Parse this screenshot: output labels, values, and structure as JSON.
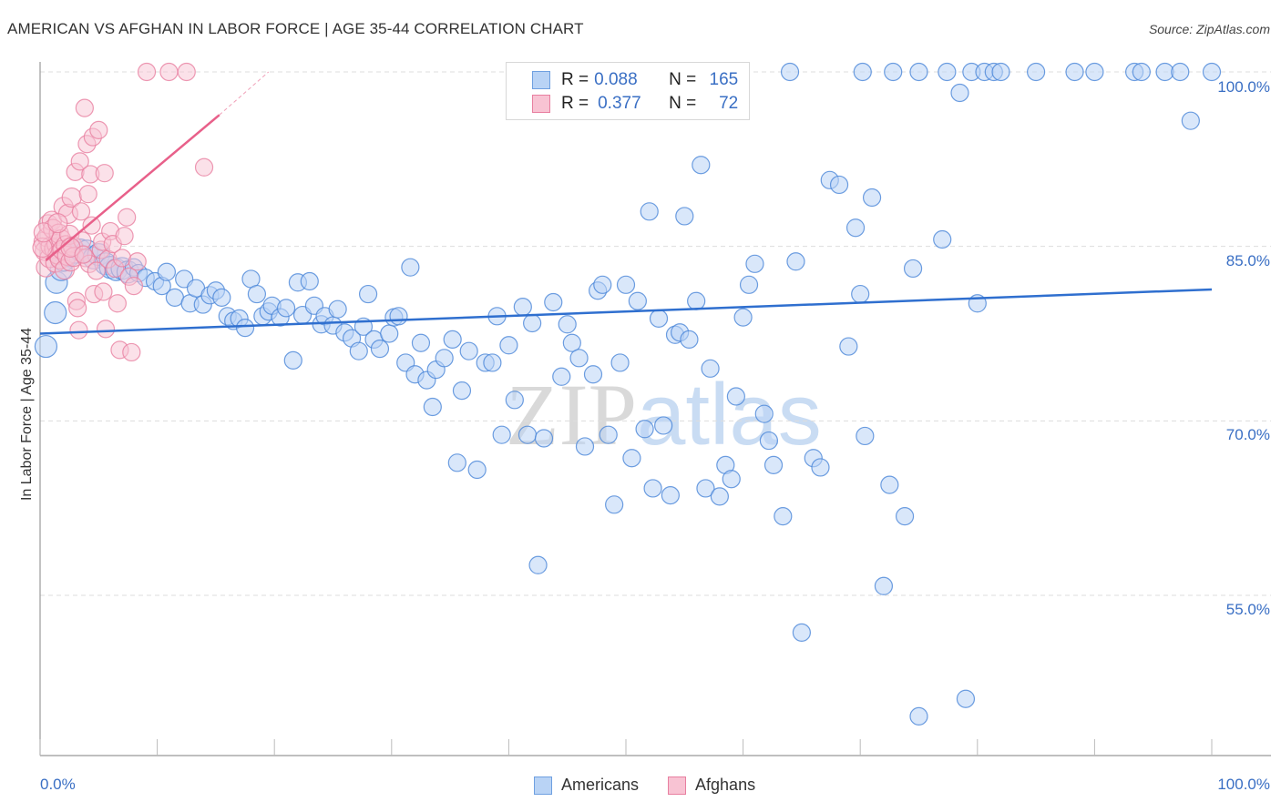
{
  "header": {
    "title": "AMERICAN VS AFGHAN IN LABOR FORCE | AGE 35-44 CORRELATION CHART",
    "source": "Source: ZipAtlas.com"
  },
  "watermark": {
    "zip": "ZIP",
    "atlas": "atlas"
  },
  "legend": {
    "rows": [
      {
        "r_label": "R = ",
        "r_value": "0.088",
        "n_label": "N = ",
        "n_value": "165",
        "color": "#6fa0e0",
        "fill": "#b9d3f5"
      },
      {
        "r_label": "R = ",
        "r_value": "0.377",
        "n_label": "N = ",
        "n_value": "72",
        "color": "#e87fa0",
        "fill": "#f8c3d3"
      }
    ]
  },
  "bottom_legend": [
    {
      "label": "Americans",
      "color": "#6fa0e0",
      "fill": "#b9d3f5"
    },
    {
      "label": "Afghans",
      "color": "#e87fa0",
      "fill": "#f8c3d3"
    }
  ],
  "chart_data": {
    "type": "scatter",
    "title": "AMERICAN VS AFGHAN IN LABOR FORCE | AGE 35-44 CORRELATION CHART",
    "xlabel": "",
    "ylabel": "In Labor Force | Age 35-44",
    "xlim": [
      0,
      100
    ],
    "ylim": [
      41.2,
      100
    ],
    "x_tick_labels": [
      "0.0%",
      "100.0%"
    ],
    "y_ticks": [
      100,
      85,
      70,
      55
    ],
    "y_tick_labels": [
      "100.0%",
      "85.0%",
      "70.0%",
      "55.0%"
    ],
    "grid": true,
    "legend_position": "top-center",
    "series": [
      {
        "name": "Americans",
        "color": "#4a86d8",
        "fill": "#b9d3f5",
        "R": 0.088,
        "N": 165,
        "trend": {
          "x": [
            0,
            100
          ],
          "y": [
            77.5,
            81.3
          ]
        },
        "points": [
          [
            0.5,
            76.4
          ],
          [
            1.3,
            79.3
          ],
          [
            1.4,
            81.9
          ],
          [
            1.8,
            83.0
          ],
          [
            2.0,
            83.8
          ],
          [
            2.5,
            84.2
          ],
          [
            3.0,
            84.5
          ],
          [
            3.4,
            84.7
          ],
          [
            4.0,
            84.6
          ],
          [
            4.6,
            84.0
          ],
          [
            5.0,
            84.3
          ],
          [
            5.6,
            83.5
          ],
          [
            6.0,
            83.2
          ],
          [
            6.5,
            83.0
          ],
          [
            7.0,
            83.1
          ],
          [
            7.5,
            82.8
          ],
          [
            8.0,
            83.2
          ],
          [
            8.4,
            82.7
          ],
          [
            9.0,
            82.3
          ],
          [
            9.8,
            82.0
          ],
          [
            10.4,
            81.6
          ],
          [
            10.8,
            82.8
          ],
          [
            11.5,
            80.6
          ],
          [
            12.3,
            82.2
          ],
          [
            12.8,
            80.1
          ],
          [
            13.3,
            81.4
          ],
          [
            13.9,
            80.0
          ],
          [
            14.5,
            80.8
          ],
          [
            15.0,
            81.2
          ],
          [
            15.5,
            80.6
          ],
          [
            16.0,
            79.0
          ],
          [
            16.5,
            78.6
          ],
          [
            17.0,
            78.8
          ],
          [
            17.5,
            78.0
          ],
          [
            18.0,
            82.2
          ],
          [
            18.5,
            80.9
          ],
          [
            19.0,
            79.0
          ],
          [
            19.5,
            79.4
          ],
          [
            19.8,
            79.9
          ],
          [
            20.5,
            78.9
          ],
          [
            21.0,
            79.7
          ],
          [
            21.6,
            75.2
          ],
          [
            22.0,
            81.9
          ],
          [
            22.4,
            79.1
          ],
          [
            23.0,
            82.0
          ],
          [
            23.4,
            79.9
          ],
          [
            24.0,
            78.3
          ],
          [
            24.3,
            79.0
          ],
          [
            25.0,
            78.2
          ],
          [
            25.4,
            79.6
          ],
          [
            26.0,
            77.6
          ],
          [
            26.6,
            77.1
          ],
          [
            27.2,
            76.0
          ],
          [
            27.6,
            78.1
          ],
          [
            28.0,
            80.9
          ],
          [
            28.5,
            77.0
          ],
          [
            29.0,
            76.2
          ],
          [
            29.8,
            77.5
          ],
          [
            30.2,
            78.9
          ],
          [
            30.6,
            79.0
          ],
          [
            31.2,
            75.0
          ],
          [
            31.6,
            83.2
          ],
          [
            32.0,
            74.0
          ],
          [
            32.5,
            76.7
          ],
          [
            33.0,
            73.5
          ],
          [
            33.5,
            71.2
          ],
          [
            33.8,
            74.4
          ],
          [
            34.5,
            75.4
          ],
          [
            35.2,
            77.0
          ],
          [
            35.6,
            66.4
          ],
          [
            36.0,
            72.6
          ],
          [
            36.6,
            76.0
          ],
          [
            37.3,
            65.8
          ],
          [
            38.0,
            75.0
          ],
          [
            38.6,
            75.0
          ],
          [
            39.0,
            79.0
          ],
          [
            39.4,
            68.8
          ],
          [
            40.0,
            76.5
          ],
          [
            40.5,
            71.8
          ],
          [
            41.2,
            79.8
          ],
          [
            41.6,
            68.8
          ],
          [
            42.0,
            78.4
          ],
          [
            42.5,
            57.6
          ],
          [
            43.0,
            68.5
          ],
          [
            43.8,
            80.2
          ],
          [
            44.5,
            73.8
          ],
          [
            45.0,
            78.3
          ],
          [
            45.4,
            76.7
          ],
          [
            46.0,
            75.4
          ],
          [
            46.5,
            67.8
          ],
          [
            47.2,
            74.0
          ],
          [
            47.6,
            81.2
          ],
          [
            48.0,
            81.7
          ],
          [
            48.5,
            68.8
          ],
          [
            49.0,
            62.8
          ],
          [
            49.5,
            75.0
          ],
          [
            50.0,
            81.7
          ],
          [
            50.5,
            66.8
          ],
          [
            51.0,
            80.3
          ],
          [
            51.6,
            69.3
          ],
          [
            52.0,
            88.0
          ],
          [
            52.3,
            64.2
          ],
          [
            52.8,
            78.8
          ],
          [
            53.2,
            69.6
          ],
          [
            53.8,
            63.6
          ],
          [
            54.2,
            77.4
          ],
          [
            54.6,
            77.6
          ],
          [
            55.0,
            87.6
          ],
          [
            55.4,
            77.0
          ],
          [
            56.0,
            80.3
          ],
          [
            56.4,
            92.0
          ],
          [
            56.8,
            64.2
          ],
          [
            57.2,
            74.5
          ],
          [
            58.0,
            63.5
          ],
          [
            58.5,
            66.2
          ],
          [
            59.0,
            65.0
          ],
          [
            59.4,
            72.1
          ],
          [
            60.0,
            78.9
          ],
          [
            60.5,
            81.7
          ],
          [
            61.0,
            83.5
          ],
          [
            61.8,
            70.6
          ],
          [
            62.2,
            68.3
          ],
          [
            62.6,
            66.2
          ],
          [
            63.4,
            61.8
          ],
          [
            64.5,
            83.7
          ],
          [
            65.0,
            51.8
          ],
          [
            66.0,
            66.8
          ],
          [
            66.6,
            66.0
          ],
          [
            67.4,
            90.7
          ],
          [
            68.2,
            90.3
          ],
          [
            69.0,
            76.4
          ],
          [
            69.6,
            86.6
          ],
          [
            70.0,
            80.9
          ],
          [
            70.4,
            68.7
          ],
          [
            71.0,
            89.2
          ],
          [
            72.0,
            55.8
          ],
          [
            72.5,
            64.5
          ],
          [
            73.8,
            61.8
          ],
          [
            74.5,
            83.1
          ],
          [
            75.0,
            44.6
          ],
          [
            77.0,
            85.6
          ],
          [
            79.0,
            46.1
          ],
          [
            80.0,
            80.1
          ],
          [
            98.2,
            95.8
          ],
          [
            64.0,
            100
          ],
          [
            70.2,
            100
          ],
          [
            72.8,
            100
          ],
          [
            75.0,
            100
          ],
          [
            77.4,
            100
          ],
          [
            79.5,
            100
          ],
          [
            80.6,
            100
          ],
          [
            81.4,
            100
          ],
          [
            82.0,
            100
          ],
          [
            85.0,
            100
          ],
          [
            88.3,
            100
          ],
          [
            90.0,
            100
          ],
          [
            93.4,
            100
          ],
          [
            94.0,
            100
          ],
          [
            96.0,
            100
          ],
          [
            97.3,
            100
          ],
          [
            100.0,
            100
          ],
          [
            78.5,
            98.2
          ]
        ]
      },
      {
        "name": "Afghans",
        "color": "#e87fa0",
        "fill": "#f8c3d3",
        "R": 0.377,
        "N": 72,
        "trend": {
          "x": [
            0.5,
            15.3
          ],
          "y": [
            83.8,
            96.3
          ],
          "dashed_extension": {
            "x": [
              15.3,
              19.5
            ],
            "y": [
              96.3,
              100
            ]
          }
        },
        "points": [
          [
            0.3,
            85.4
          ],
          [
            0.4,
            84.6
          ],
          [
            0.5,
            83.2
          ],
          [
            0.6,
            85.8
          ],
          [
            0.7,
            86.9
          ],
          [
            0.8,
            84.0
          ],
          [
            0.9,
            85.0
          ],
          [
            1.0,
            87.2
          ],
          [
            1.1,
            86.5
          ],
          [
            1.2,
            84.8
          ],
          [
            1.3,
            83.6
          ],
          [
            1.4,
            85.2
          ],
          [
            1.5,
            84.3
          ],
          [
            1.6,
            86.1
          ],
          [
            1.7,
            83.9
          ],
          [
            1.8,
            85.6
          ],
          [
            1.9,
            84.7
          ],
          [
            2.0,
            88.4
          ],
          [
            2.1,
            83.0
          ],
          [
            2.2,
            85.1
          ],
          [
            2.3,
            84.2
          ],
          [
            2.4,
            87.8
          ],
          [
            2.5,
            86.0
          ],
          [
            2.6,
            83.7
          ],
          [
            2.7,
            89.2
          ],
          [
            2.8,
            85.0
          ],
          [
            2.9,
            84.1
          ],
          [
            3.0,
            91.4
          ],
          [
            3.1,
            80.3
          ],
          [
            3.2,
            79.7
          ],
          [
            3.3,
            77.8
          ],
          [
            3.4,
            92.3
          ],
          [
            3.5,
            88.0
          ],
          [
            3.6,
            85.5
          ],
          [
            3.8,
            96.9
          ],
          [
            3.9,
            84.0
          ],
          [
            4.0,
            93.8
          ],
          [
            4.1,
            89.5
          ],
          [
            4.2,
            83.5
          ],
          [
            4.3,
            91.2
          ],
          [
            4.4,
            86.8
          ],
          [
            4.5,
            94.4
          ],
          [
            4.6,
            80.9
          ],
          [
            4.8,
            82.9
          ],
          [
            5.0,
            95.0
          ],
          [
            5.2,
            84.7
          ],
          [
            5.3,
            85.4
          ],
          [
            5.4,
            81.1
          ],
          [
            5.5,
            91.3
          ],
          [
            5.6,
            77.9
          ],
          [
            5.8,
            83.9
          ],
          [
            6.0,
            86.3
          ],
          [
            6.2,
            85.2
          ],
          [
            6.4,
            83.1
          ],
          [
            6.6,
            80.1
          ],
          [
            6.8,
            76.1
          ],
          [
            7.0,
            84.0
          ],
          [
            7.2,
            85.9
          ],
          [
            7.4,
            87.5
          ],
          [
            7.6,
            82.4
          ],
          [
            7.8,
            75.9
          ],
          [
            8.0,
            81.6
          ],
          [
            8.3,
            83.7
          ],
          [
            9.1,
            100
          ],
          [
            11.0,
            100
          ],
          [
            12.5,
            100
          ],
          [
            14.0,
            91.8
          ],
          [
            0.2,
            84.9
          ],
          [
            0.3,
            86.2
          ],
          [
            1.5,
            87.0
          ],
          [
            2.6,
            84.9
          ],
          [
            3.7,
            84.3
          ]
        ]
      }
    ]
  }
}
